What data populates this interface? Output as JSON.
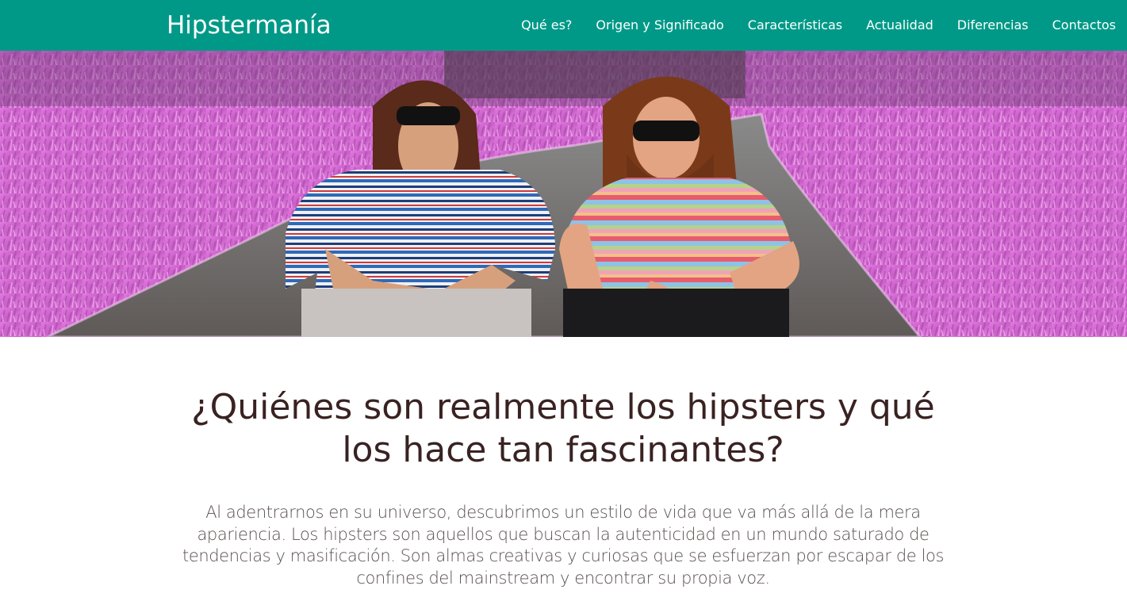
{
  "brand": {
    "name": "Hipstermanía"
  },
  "nav": {
    "items": [
      {
        "label": "Qué es?"
      },
      {
        "label": "Origen y Significado"
      },
      {
        "label": "Características"
      },
      {
        "label": "Actualidad"
      },
      {
        "label": "Diferencias"
      },
      {
        "label": "Contactos"
      }
    ]
  },
  "hero": {
    "image": "hipsters-on-road-photo"
  },
  "main": {
    "headline": "¿Quiénes son realmente los hipsters y qué los hace tan fascinantes?",
    "intro": "Al adentrarnos en su universo, descubrimos un estilo de vida que va más allá de la mera apariencia. Los hipsters son aquellos que buscan la autenticidad en un mundo saturado de tendencias y masificación. Son almas creativas y curiosas que se esfuerzan por escapar de los confines del mainstream y encontrar su propia voz."
  },
  "colors": {
    "navbar": "#009987",
    "nav_text": "#ffffff",
    "headline": "#3a2222",
    "body_text": "#5a5050",
    "foliage": "#d873d6"
  }
}
